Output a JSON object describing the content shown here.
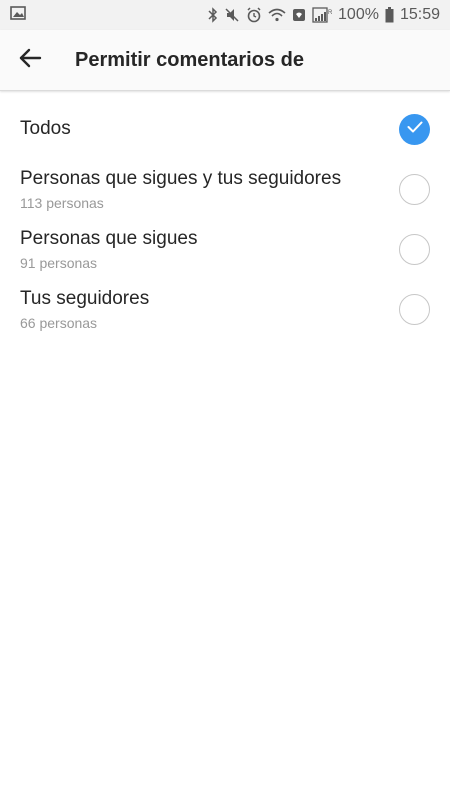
{
  "status_bar": {
    "battery": "100%",
    "time": "15:59"
  },
  "header": {
    "title": "Permitir comentarios de",
    "back_icon": "arrow-left-icon"
  },
  "options": [
    {
      "label": "Todos",
      "subtitle": "",
      "selected": true
    },
    {
      "label": "Personas que sigues y tus seguidores",
      "subtitle": "113 personas",
      "selected": false
    },
    {
      "label": "Personas que sigues",
      "subtitle": "91 personas",
      "selected": false
    },
    {
      "label": "Tus seguidores",
      "subtitle": "66 personas",
      "selected": false
    }
  ],
  "colors": {
    "accent": "#3897f0",
    "text": "#262626",
    "subtext": "#999999"
  }
}
